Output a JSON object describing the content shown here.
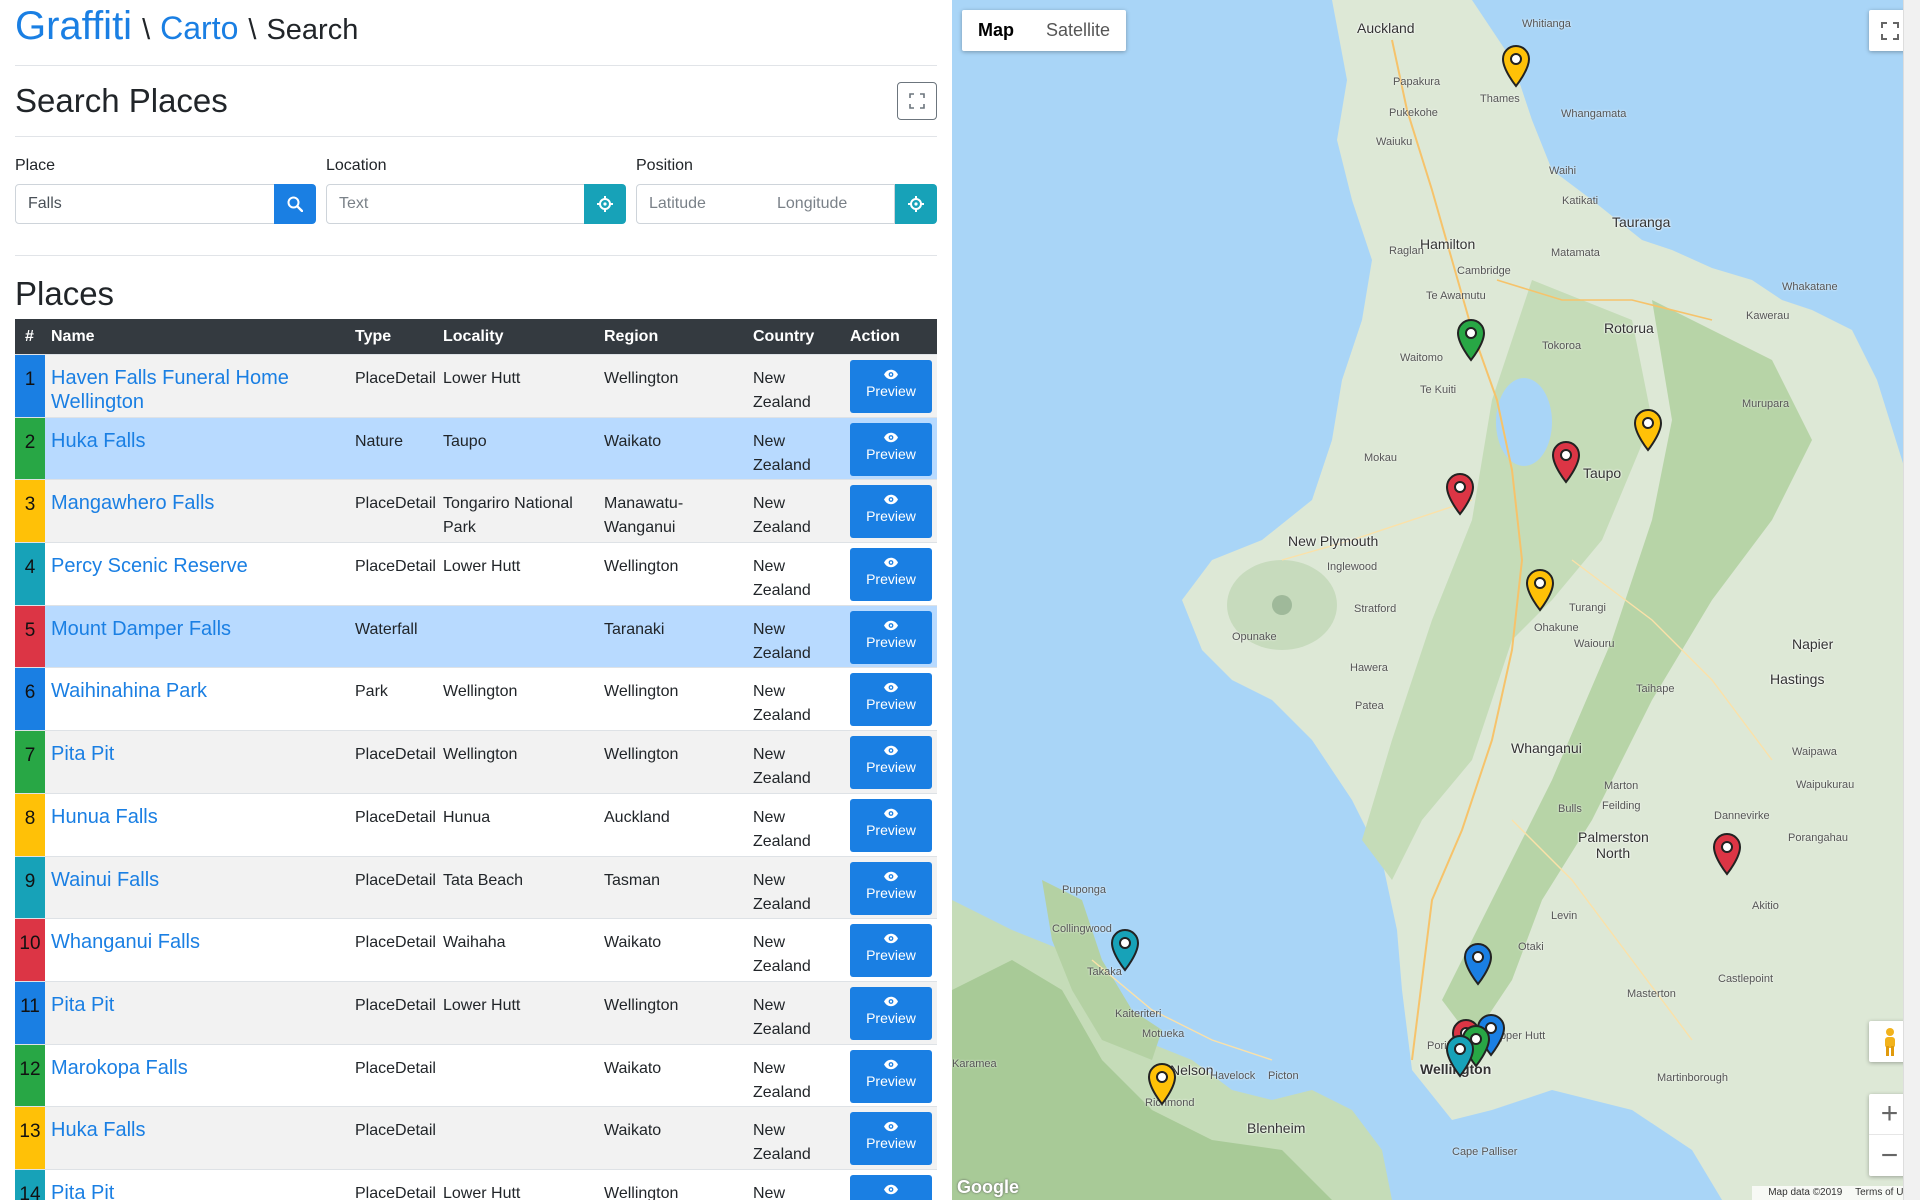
{
  "breadcrumb": {
    "brand": "Graffiti",
    "sep1": "\\",
    "crumb": "Carto",
    "sep2": "\\",
    "current": "Search"
  },
  "search": {
    "title": "Search Places",
    "place_label": "Place",
    "place_value": "Falls",
    "location_label": "Location",
    "location_placeholder": "Text",
    "position_label": "Position",
    "latitude_placeholder": "Latitude",
    "longitude_placeholder": "Longitude"
  },
  "places": {
    "title": "Places",
    "columns": {
      "num": "#",
      "name": "Name",
      "type": "Type",
      "locality": "Locality",
      "region": "Region",
      "country": "Country",
      "action": "Action"
    },
    "action_label": "Preview",
    "rows": [
      {
        "num": "1",
        "name": "Haven Falls Funeral Home Wellington",
        "type": "PlaceDetail",
        "locality": "Lower Hutt",
        "region": "Wellington",
        "country": "New Zealand",
        "color": "#1a7fe3",
        "highlight": false
      },
      {
        "num": "2",
        "name": "Huka Falls",
        "type": "Nature",
        "locality": "Taupo",
        "region": "Waikato",
        "country": "New Zealand",
        "color": "#28a745",
        "highlight": true
      },
      {
        "num": "3",
        "name": "Mangawhero Falls",
        "type": "PlaceDetail",
        "locality": "Tongariro National Park",
        "region": "Manawatu-Wanganui",
        "country": "New Zealand",
        "color": "#ffc107",
        "highlight": false
      },
      {
        "num": "4",
        "name": "Percy Scenic Reserve",
        "type": "PlaceDetail",
        "locality": "Lower Hutt",
        "region": "Wellington",
        "country": "New Zealand",
        "color": "#17a2b8",
        "highlight": false
      },
      {
        "num": "5",
        "name": "Mount Damper Falls",
        "type": "Waterfall",
        "locality": "",
        "region": "Taranaki",
        "country": "New Zealand",
        "color": "#dc3545",
        "highlight": true
      },
      {
        "num": "6",
        "name": "Waihinahina Park",
        "type": "Park",
        "locality": "Wellington",
        "region": "Wellington",
        "country": "New Zealand",
        "color": "#1a7fe3",
        "highlight": false
      },
      {
        "num": "7",
        "name": "Pita Pit",
        "type": "PlaceDetail",
        "locality": "Wellington",
        "region": "Wellington",
        "country": "New Zealand",
        "color": "#28a745",
        "highlight": false
      },
      {
        "num": "8",
        "name": "Hunua Falls",
        "type": "PlaceDetail",
        "locality": "Hunua",
        "region": "Auckland",
        "country": "New Zealand",
        "color": "#ffc107",
        "highlight": false
      },
      {
        "num": "9",
        "name": "Wainui Falls",
        "type": "PlaceDetail",
        "locality": "Tata Beach",
        "region": "Tasman",
        "country": "New Zealand",
        "color": "#17a2b8",
        "highlight": false
      },
      {
        "num": "10",
        "name": "Whanganui Falls",
        "type": "PlaceDetail",
        "locality": "Waihaha",
        "region": "Waikato",
        "country": "New Zealand",
        "color": "#dc3545",
        "highlight": false
      },
      {
        "num": "11",
        "name": "Pita Pit",
        "type": "PlaceDetail",
        "locality": "Lower Hutt",
        "region": "Wellington",
        "country": "New Zealand",
        "color": "#1a7fe3",
        "highlight": false
      },
      {
        "num": "12",
        "name": "Marokopa Falls",
        "type": "PlaceDetail",
        "locality": "",
        "region": "Waikato",
        "country": "New Zealand",
        "color": "#28a745",
        "highlight": false
      },
      {
        "num": "13",
        "name": "Huka Falls",
        "type": "PlaceDetail",
        "locality": "",
        "region": "Waikato",
        "country": "New Zealand",
        "color": "#ffc107",
        "highlight": false
      },
      {
        "num": "14",
        "name": "Pita Pit",
        "type": "PlaceDetail",
        "locality": "Lower Hutt",
        "region": "Wellington",
        "country": "New",
        "color": "#17a2b8",
        "highlight": false
      }
    ]
  },
  "map": {
    "map_type_map": "Map",
    "map_type_satellite": "Satellite",
    "zoom_in": "+",
    "zoom_out": "−",
    "google": "Google",
    "attribution": "Map data ©2019",
    "terms": "Terms of Use",
    "cities": [
      "Auckland",
      "Hamilton",
      "Tauranga",
      "Rotorua",
      "Taupo",
      "New Plymouth",
      "Napier",
      "Hastings",
      "Whanganui",
      "Palmerston North",
      "Wellington",
      "Blenheim",
      "Nelson"
    ],
    "towns": [
      "Papakura",
      "Pukekohe",
      "Thames",
      "Whitianga",
      "Waihi",
      "Katikati",
      "Raglan",
      "Cambridge",
      "Te Awamutu",
      "Matamata",
      "Tokoroa",
      "Whakatane",
      "Kawerau",
      "Waitomo",
      "Te Kuiti",
      "Mokau",
      "Murupara",
      "Turangi",
      "Ohakune",
      "Waiouru",
      "Stratford",
      "Hawera",
      "Opunake",
      "Inglewood",
      "Taihape",
      "Marton",
      "Bulls",
      "Feilding",
      "Dannevirke",
      "Levin",
      "Otaki",
      "Masterton",
      "Martinborough",
      "Upper Hutt",
      "Porirua",
      "Picton",
      "Havelock",
      "Richmond",
      "Motueka",
      "Takaka",
      "Collingwood",
      "Puponga",
      "Karamea",
      "Kaiteriteri",
      "Cape Palliser",
      "Waipukurau",
      "Porangahau",
      "Akitio",
      "Castlepoint",
      "Waipawa",
      "Patea",
      "Whangamata",
      "Waiuku"
    ]
  }
}
